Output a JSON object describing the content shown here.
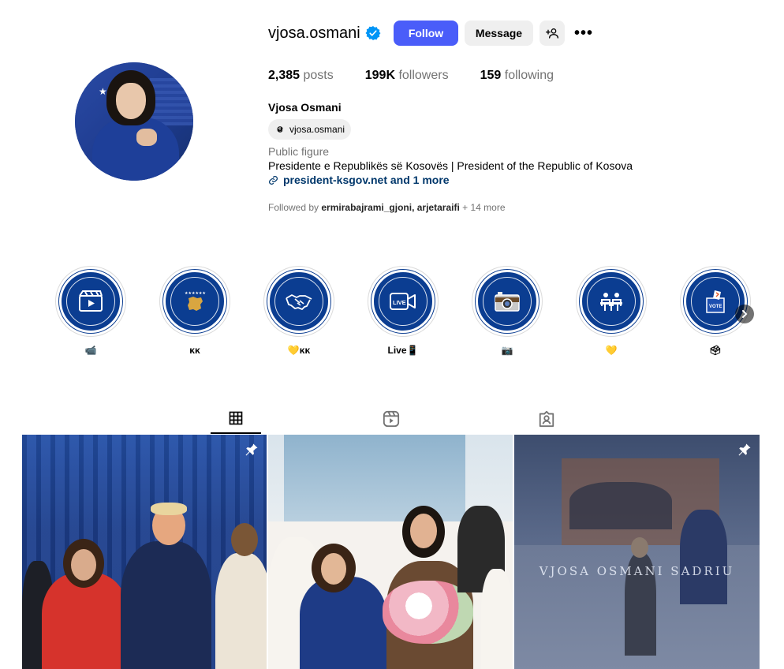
{
  "profile": {
    "username": "vjosa.osmani",
    "full_name": "Vjosa Osmani",
    "threads_handle": "vjosa.osmani",
    "category": "Public figure",
    "bio": "Presidente e Republikës së Kosovës | President of the Republic of Kosova",
    "link_text": "president-ksgov.net and 1 more",
    "followed_by_prefix": "Followed by",
    "followed_by_names": "ermirabajrami_gjoni, arjetaraifi",
    "followed_by_more": "+ 14 more"
  },
  "buttons": {
    "follow": "Follow",
    "message": "Message",
    "more": "•••"
  },
  "stats": {
    "posts_count": "2,385",
    "posts_label": "posts",
    "followers_count": "199K",
    "followers_label": "followers",
    "following_count": "159",
    "following_label": "following"
  },
  "highlights": [
    {
      "label": "📹",
      "icon": "video-clapper-icon"
    },
    {
      "label": "ᴋᴋ",
      "icon": "kosovo-map-icon"
    },
    {
      "label": "💛ᴋᴋ",
      "icon": "handshake-icon"
    },
    {
      "label": "Live📱",
      "icon": "live-camera-icon"
    },
    {
      "label": "📷",
      "icon": "camera-icon"
    },
    {
      "label": "💛",
      "icon": "meeting-table-icon"
    },
    {
      "label": "🗳",
      "icon": "ballot-box-icon"
    }
  ],
  "tabs": [
    "grid-icon",
    "reels-icon",
    "tagged-icon"
  ],
  "posts": [
    {
      "pinned": true
    },
    {
      "pinned": false
    },
    {
      "pinned": true,
      "overlay_text": "VJOSA OSMANI SADRIU"
    }
  ],
  "colors": {
    "follow_button": "#4a5df9",
    "verified": "#0095f6",
    "link": "#00376b",
    "highlight_bg": "#0b3d91"
  }
}
